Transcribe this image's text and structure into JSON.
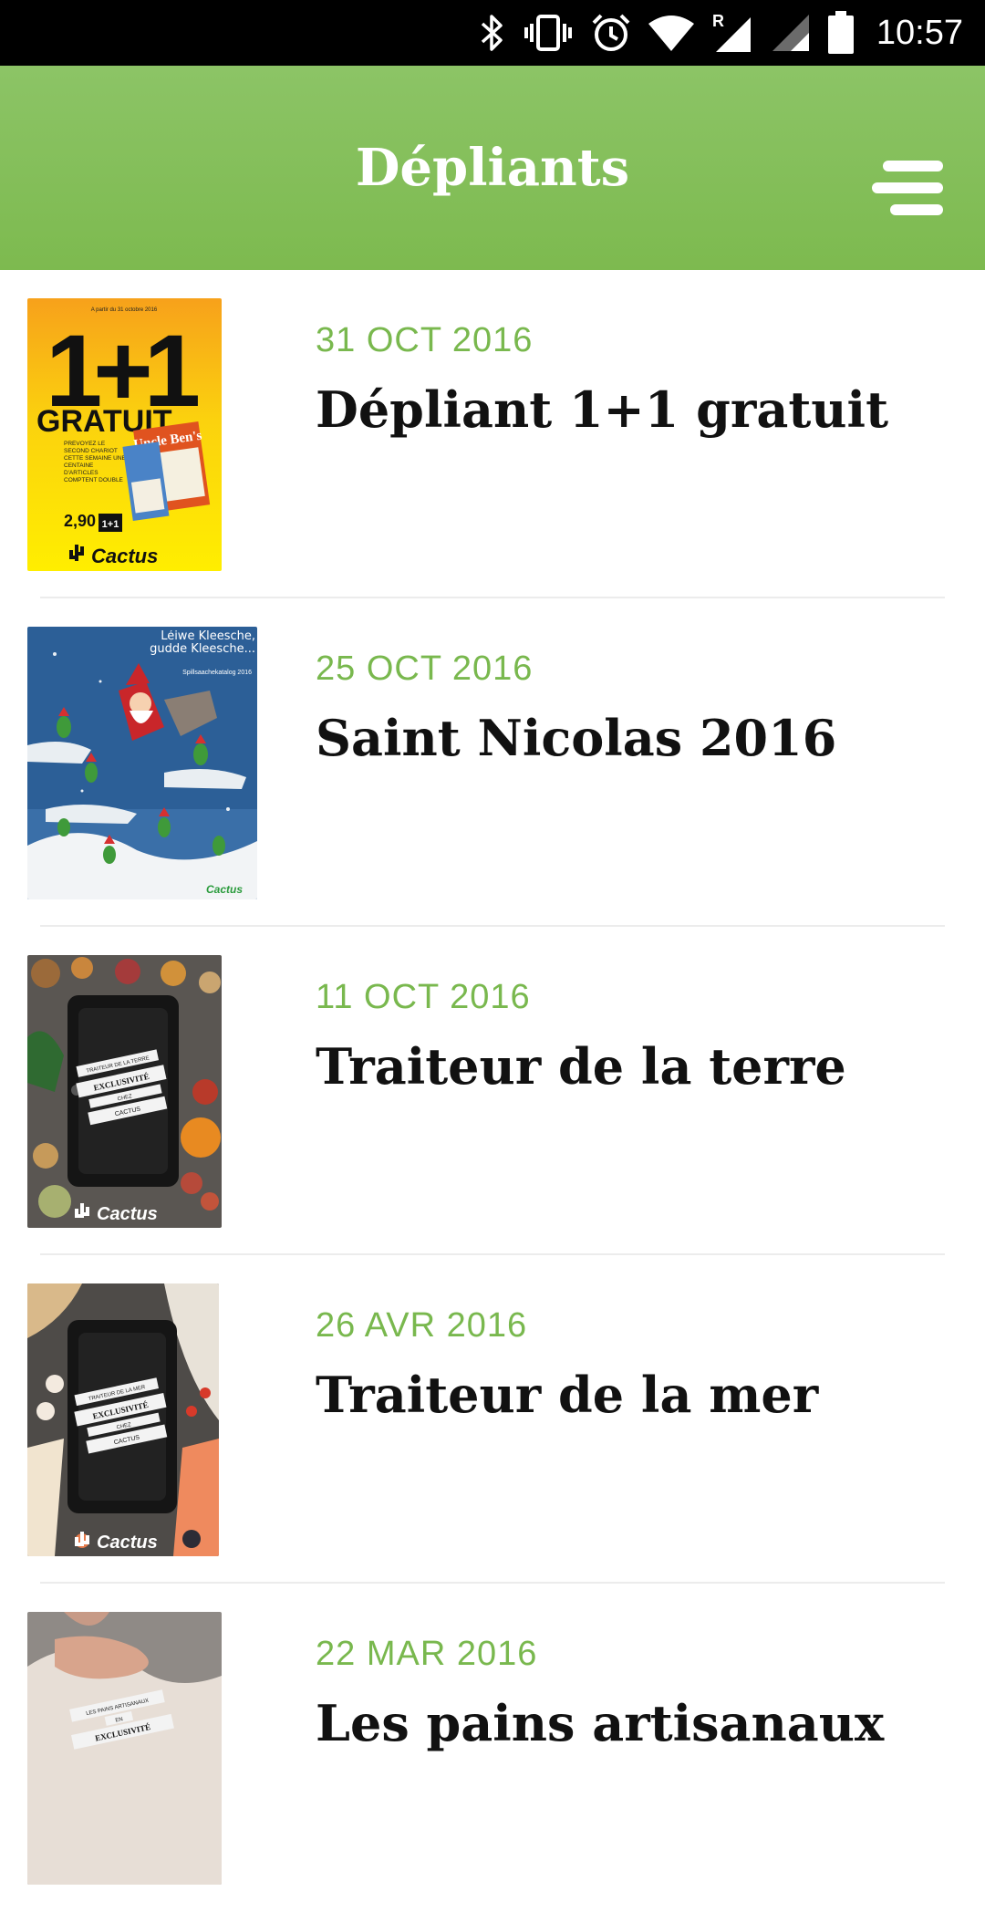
{
  "status_bar": {
    "time": "10:57",
    "icons": [
      "bluetooth-icon",
      "vibrate-icon",
      "alarm-icon",
      "wifi-icon",
      "signal-roaming-icon",
      "signal-icon",
      "battery-icon"
    ]
  },
  "app_bar": {
    "title": "Dépliants",
    "menu_icon": "menu-icon"
  },
  "colors": {
    "accent_green": "#7dba4f",
    "date_green": "#79b84e",
    "title_text": "#111111"
  },
  "leaflets": [
    {
      "date": "31 OCT 2016",
      "title": "Dépliant 1+1 gratuit",
      "cover": {
        "headline": "1+1",
        "subline": "GRATUIT",
        "top_note": "A partir du 31 octobre 2016",
        "body": "PRÉVOYEZ LE SECOND CHARIOT CETTE SEMAINE UNE CENTAINE D'ARTICLES COMPTENT DOUBLE",
        "price": "2,90",
        "product": "Uncle Ben's",
        "brand": "Cactus"
      }
    },
    {
      "date": "25 OCT 2016",
      "title": "Saint Nicolas 2016",
      "cover": {
        "headline": "Léiwe Kleesche, gudde Kleesche...",
        "subline": "Spillsaachekatalog 2016",
        "brand": "Cactus"
      }
    },
    {
      "date": "11 OCT 2016",
      "title": "Traiteur de la terre",
      "cover": {
        "ribbon_top": "TRAITEUR DE LA TERRE",
        "ribbon_mid": "EXCLUSIVITÉ",
        "ribbon_small": "CHEZ",
        "ribbon_bottom": "CACTUS",
        "brand": "Cactus"
      }
    },
    {
      "date": "26 AVR 2016",
      "title": "Traiteur de la mer",
      "cover": {
        "ribbon_top": "TRAITEUR DE LA MER",
        "ribbon_mid": "EXCLUSIVITÉ",
        "ribbon_small": "CHEZ",
        "ribbon_bottom": "CACTUS",
        "brand": "Cactus"
      }
    },
    {
      "date": "22 MAR 2016",
      "title": "Les pains artisanaux",
      "cover": {
        "ribbon_top": "LES PAINS ARTISANAUX",
        "ribbon_small": "EN",
        "ribbon_mid": "EXCLUSIVITÉ"
      }
    }
  ]
}
